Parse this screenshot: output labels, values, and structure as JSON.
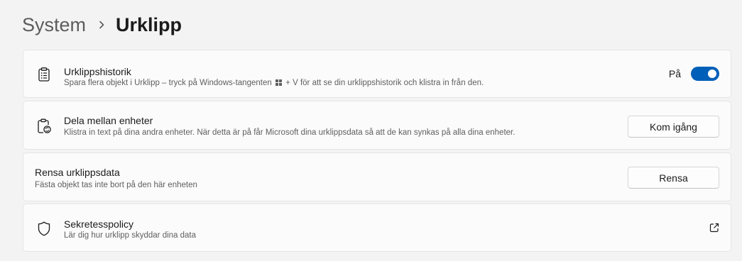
{
  "breadcrumb": {
    "parent": "System",
    "current": "Urklipp"
  },
  "clipboard_history": {
    "title": "Urklippshistorik",
    "desc_before": "Spara flera objekt i Urklipp – tryck på Windows-tangenten",
    "desc_after": "+ V för att se din urklippshistorik och klistra in från den.",
    "toggle_label": "På",
    "toggle_on": true,
    "accent_color": "#005fb8"
  },
  "share_devices": {
    "title": "Dela mellan enheter",
    "desc": "Klistra in text på dina andra enheter. När detta är på får Microsoft dina urklippsdata så att de kan synkas på alla dina enheter.",
    "button_label": "Kom igång"
  },
  "clear_data": {
    "title": "Rensa urklippsdata",
    "desc": "Fästa objekt tas inte bort på den här enheten",
    "button_label": "Rensa"
  },
  "privacy": {
    "title": "Sekretesspolicy",
    "desc": "Lär dig hur urklipp skyddar dina data"
  }
}
